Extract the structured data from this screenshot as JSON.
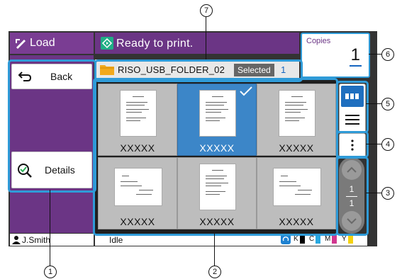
{
  "title_bar": {
    "load_label": "Load",
    "status_text": "Ready to print."
  },
  "copies": {
    "label": "Copies",
    "value": "1"
  },
  "folder": {
    "name": "RISO_USB_FOLDER_02",
    "selected_label": "Selected",
    "selected_count": "1"
  },
  "left_panel": {
    "back_label": "Back",
    "details_label": "Details"
  },
  "thumbnails": [
    {
      "name": "XXXXX",
      "selected": false
    },
    {
      "name": "XXXXX",
      "selected": true
    },
    {
      "name": "XXXXX",
      "selected": false
    },
    {
      "name": "XXXXX",
      "selected": false
    },
    {
      "name": "XXXXX",
      "selected": false
    },
    {
      "name": "XXXXX",
      "selected": false
    }
  ],
  "pager": {
    "current": "1",
    "total": "1"
  },
  "footer": {
    "user": "J.Smith",
    "status": "Idle",
    "ink": [
      {
        "label": "K",
        "color": "#000000"
      },
      {
        "label": "C",
        "color": "#29a8e0"
      },
      {
        "label": "M",
        "color": "#d1378f"
      },
      {
        "label": "Y",
        "color": "#f5d20e"
      }
    ]
  },
  "callouts": [
    "1",
    "2",
    "3",
    "4",
    "5",
    "6",
    "7"
  ],
  "colors": {
    "brand_purple": "#6b3585",
    "highlight_blue": "#2f9bd8",
    "selection_blue": "#3c86c8"
  }
}
